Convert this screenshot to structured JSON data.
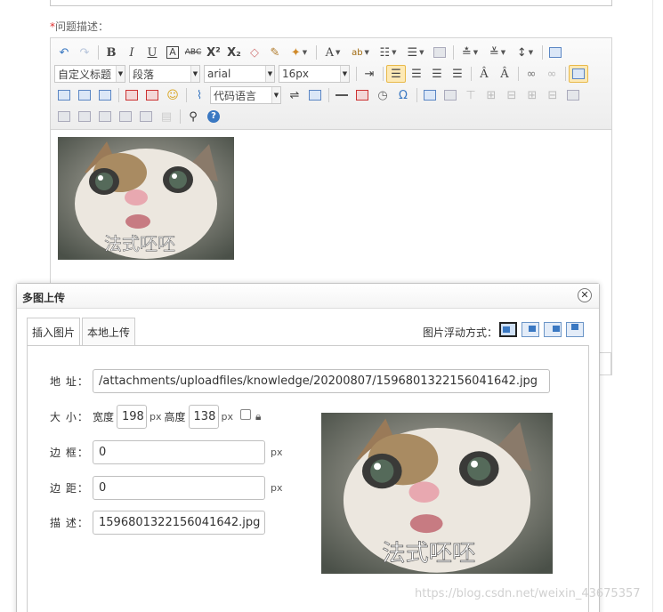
{
  "form": {
    "required_mark": "*",
    "field_label": "问题描述："
  },
  "toolbar": {
    "heading_select": "自定义标题",
    "paragraph_select": "段落",
    "font_select": "arial",
    "size_select": "16px",
    "code_select": "代码语言",
    "bold": "B",
    "italic": "I",
    "underline": "U",
    "font_border": "A",
    "strike": "ABC",
    "superscript": "X²",
    "subscript": "X₂",
    "font_color": "A",
    "omega": "Ω"
  },
  "dialog": {
    "title": "多图上传",
    "close": "✕",
    "tabs": [
      {
        "label": "插入图片",
        "active": true
      },
      {
        "label": "本地上传",
        "active": false
      }
    ],
    "float_label": "图片浮动方式：",
    "fields": {
      "address_label": "地 址：",
      "address_value": "/attachments/uploadfiles/knowledge/20200807/1596801322156041642.jpg",
      "size_label": "大 小：",
      "width_label": "宽度",
      "width_value": "198",
      "width_unit": "px",
      "height_label": "高度",
      "height_value": "138",
      "height_unit": "px",
      "border_label": "边 框：",
      "border_value": "0",
      "border_unit": "px",
      "margin_label": "边 距：",
      "margin_value": "0",
      "margin_unit": "px",
      "desc_label": "描 述：",
      "desc_value": "1596801322156041642.jpg"
    },
    "preview_caption": "法式呸呸"
  },
  "content": {
    "image_caption": "法式呸呸"
  },
  "watermark": "https://blog.csdn.net/weixin_43675357",
  "colors": {
    "required": "#e03030",
    "active_button": "#fde9b5",
    "icon_blue": "#3a78c2"
  }
}
